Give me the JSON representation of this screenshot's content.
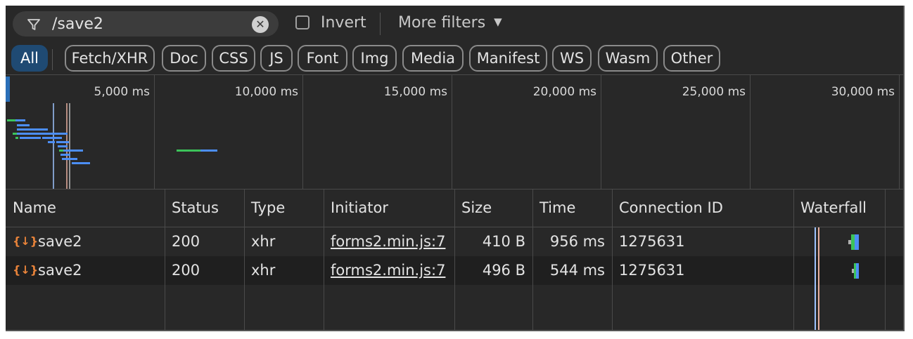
{
  "toolbar": {
    "filter_value": "/save2",
    "clear_icon": "✕",
    "invert_label": "Invert",
    "more_filters_label": "More filters",
    "more_filters_caret": "▼"
  },
  "type_filters": [
    "All",
    "Fetch/XHR",
    "Doc",
    "CSS",
    "JS",
    "Font",
    "Img",
    "Media",
    "Manifest",
    "WS",
    "Wasm",
    "Other"
  ],
  "active_type_filter": "All",
  "overview": {
    "ticks": [
      "5,000 ms",
      "10,000 ms",
      "15,000 ms",
      "20,000 ms",
      "25,000 ms",
      "30,000 ms"
    ]
  },
  "table": {
    "columns": [
      "Name",
      "Status",
      "Type",
      "Initiator",
      "Size",
      "Time",
      "Connection ID",
      "Waterfall"
    ],
    "rows": [
      {
        "name": "save2",
        "status": "200",
        "type": "xhr",
        "initiator": "forms2.min.js:7",
        "size": "410 B",
        "time": "956 ms",
        "connection_id": "1275631"
      },
      {
        "name": "save2",
        "status": "200",
        "type": "xhr",
        "initiator": "forms2.min.js:7",
        "size": "496 B",
        "time": "544 ms",
        "connection_id": "1275631"
      }
    ]
  },
  "colors": {
    "accent_blue": "#4c8ef5",
    "accent_green": "#3cc35a",
    "xhr_orange": "#e8833a",
    "active_chip": "#1f4a73"
  },
  "icons": {
    "filter": "funnel-icon",
    "clear": "clear-filter-icon",
    "xhr": "xhr-request-icon"
  }
}
